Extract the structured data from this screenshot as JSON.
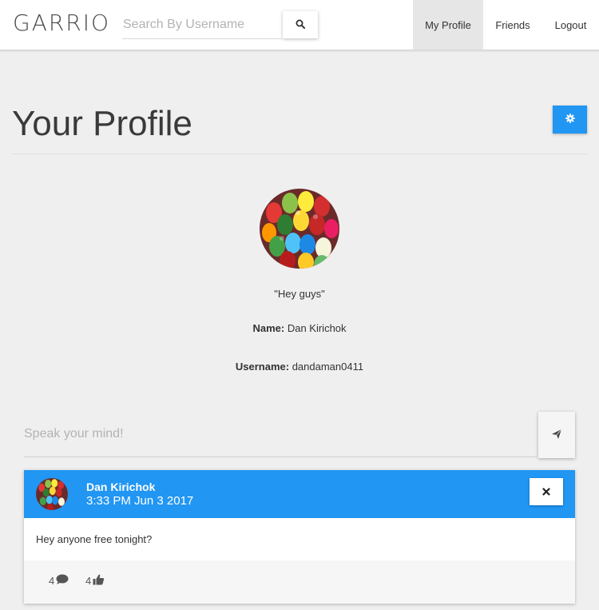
{
  "navbar": {
    "brand": "GARRIO",
    "search_placeholder": "Search By Username",
    "search_value": "",
    "links": [
      "My Profile",
      "Friends",
      "Logout"
    ],
    "active_link": "My Profile"
  },
  "header": {
    "title": "Your Profile"
  },
  "profile": {
    "status": "\"Hey guys\"",
    "name_label": "Name:",
    "name": "Dan Kirichok",
    "username_label": "Username:",
    "username": "dandaman0411"
  },
  "composer": {
    "placeholder": "Speak your mind!",
    "value": ""
  },
  "post": {
    "author": "Dan Kirichok",
    "timestamp": "3:33 PM Jun 3 2017",
    "body": "Hey anyone free tonight?",
    "comments": "4",
    "likes": "4"
  },
  "colors": {
    "accent": "#2196f3",
    "background": "#efefef"
  },
  "icons": {
    "search": "search-icon",
    "settings": "gear-icon",
    "send": "paper-plane-icon",
    "delete": "close-icon",
    "comment": "comment-icon",
    "like": "thumbs-up-icon"
  }
}
